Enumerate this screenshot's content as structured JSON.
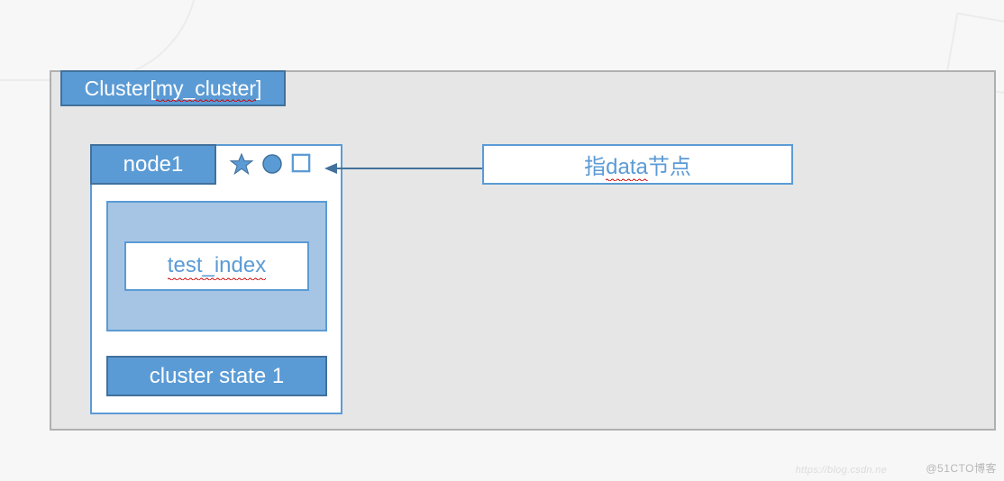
{
  "cluster": {
    "title": "Cluster[my_cluster]",
    "title_underlined": "my_cluster"
  },
  "node": {
    "title": "node1",
    "icons": [
      "star",
      "circle",
      "square"
    ],
    "index": {
      "name": "test_index"
    },
    "state_label": "cluster state 1"
  },
  "callout": {
    "text": "指data节点",
    "underlined": "data"
  },
  "watermark_main": "@51CTO博客",
  "watermark_faint": "https://blog.csdn.ne",
  "colors": {
    "accent": "#5b9bd5",
    "accent_border": "#41719c",
    "light_fill": "#a6c5e4",
    "container_bg": "#e6e6e6",
    "container_border": "#b0b0b0"
  }
}
